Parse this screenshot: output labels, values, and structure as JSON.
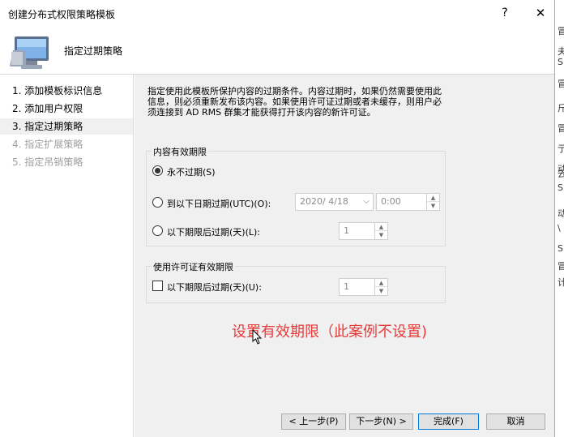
{
  "window": {
    "title": "创建分布式权限策略模板",
    "help_glyph": "?",
    "close_glyph": "✕"
  },
  "header": {
    "title": "指定过期策略",
    "icon": "computer-monitor-icon"
  },
  "sidebar": {
    "steps": [
      {
        "label": "1.  添加模板标识信息",
        "state": "normal"
      },
      {
        "label": "2.  添加用户权限",
        "state": "normal"
      },
      {
        "label": "3.  指定过期策略",
        "state": "active"
      },
      {
        "label": "4.  指定扩展策略",
        "state": "disabled"
      },
      {
        "label": "5.  指定吊销策略",
        "state": "disabled"
      }
    ]
  },
  "main": {
    "description": "指定使用此模板所保护内容的过期条件。内容过期时，如果仍然需要使用此信息，则必须重新发布该内容。如果使用许可证过期或者未缓存，则用户必须连接到 AD RMS 群集才能获得打开该内容的新许可证。",
    "content_expiration": {
      "legend": "内容有效期限",
      "never_label": "永不过期(S)",
      "on_date_label": "到以下日期过期(UTC)(O):",
      "date_value": "2020/ 4/18",
      "time_value": "0:00",
      "after_days_label": "以下期限后过期(天)(L):",
      "days_value": "1",
      "selected": "never"
    },
    "license_expiration": {
      "legend": "使用许可证有效期限",
      "after_days_label": "以下期限后过期(天)(U):",
      "days_value": "1",
      "checked": false
    },
    "annotation": "设置有效期限（此案例不设置)"
  },
  "footer": {
    "prev_label": "< 上一步(P)",
    "next_label": "下一步(N) >",
    "finish_label": "完成(F)",
    "cancel_label": "取消"
  },
  "background_window": {
    "glyphs": [
      "冒",
      "夫",
      "S",
      "冒",
      "斤",
      "冒",
      "亍",
      "动",
      "云",
      "S",
      "动",
      "\\",
      "S",
      "冒",
      "计"
    ]
  },
  "colors": {
    "annotation": "#e83a3a",
    "main_bg": "#f0f0f0",
    "primary_border": "#0078d7"
  }
}
